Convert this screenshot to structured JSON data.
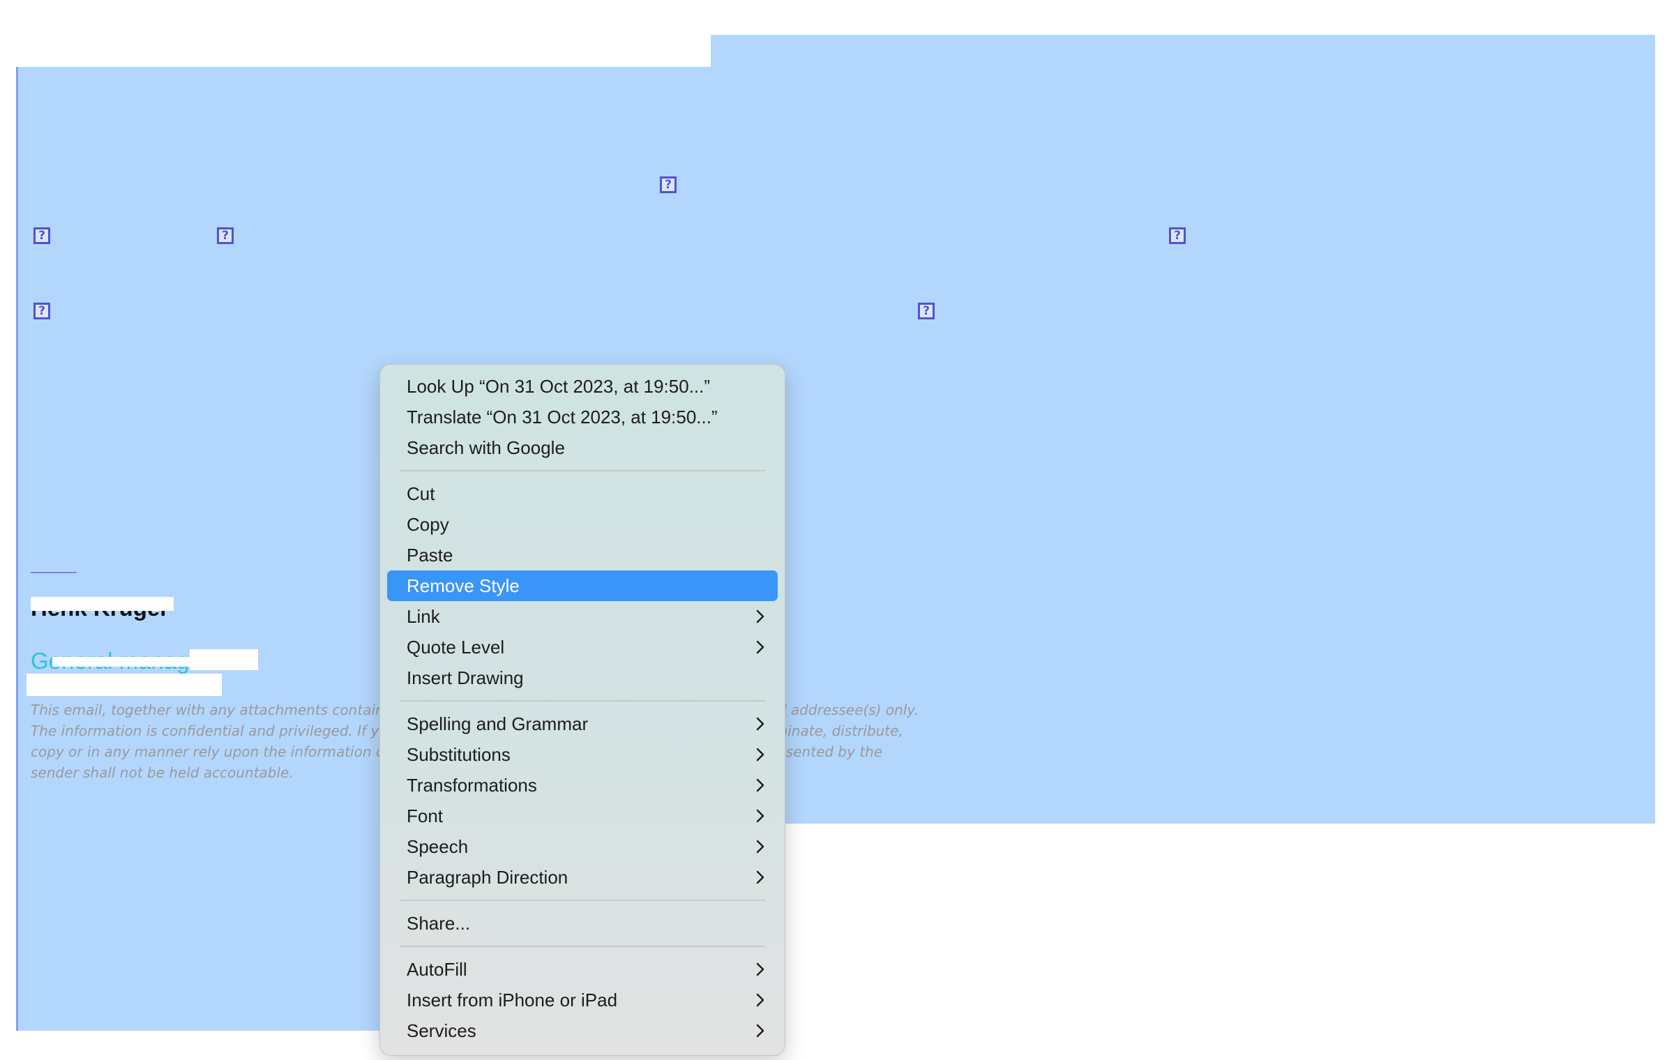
{
  "placeholder_glyph": "?",
  "signature": {
    "name": "Henk Kruger",
    "title": "General manager"
  },
  "disclaimer_text": "This email, together with any attachments contains information intended for the exclusive use of the stated addressee(s) only. The information is confidential and privileged. If you are not the stated addressee, you may not use, disseminate, distribute, copy or in any manner rely upon the information contained in this email. The sender and/or the entity represented by the sender shall not be held accountable.",
  "context_menu": {
    "groups": [
      [
        {
          "label": "Look Up “On 31 Oct 2023, at 19:50...”",
          "submenu": false
        },
        {
          "label": "Translate “On 31 Oct 2023, at 19:50...”",
          "submenu": false
        },
        {
          "label": "Search with Google",
          "submenu": false
        }
      ],
      [
        {
          "label": "Cut",
          "submenu": false
        },
        {
          "label": "Copy",
          "submenu": false
        },
        {
          "label": "Paste",
          "submenu": false
        },
        {
          "label": "Remove Style",
          "submenu": false,
          "highlighted": true
        },
        {
          "label": "Link",
          "submenu": true
        },
        {
          "label": "Quote Level",
          "submenu": true
        },
        {
          "label": "Insert Drawing",
          "submenu": false
        }
      ],
      [
        {
          "label": "Spelling and Grammar",
          "submenu": true
        },
        {
          "label": "Substitutions",
          "submenu": true
        },
        {
          "label": "Transformations",
          "submenu": true
        },
        {
          "label": "Font",
          "submenu": true
        },
        {
          "label": "Speech",
          "submenu": true
        },
        {
          "label": "Paragraph Direction",
          "submenu": true
        }
      ],
      [
        {
          "label": "Share...",
          "submenu": false
        }
      ],
      [
        {
          "label": "AutoFill",
          "submenu": true
        },
        {
          "label": "Insert from iPhone or iPad",
          "submenu": true
        },
        {
          "label": "Services",
          "submenu": true
        }
      ]
    ]
  },
  "colors": {
    "selection": "#b3d6fd",
    "highlight": "#3a95f8",
    "title_accent": "#2ec3dc",
    "placeholder_icon": "#4d55cf"
  }
}
